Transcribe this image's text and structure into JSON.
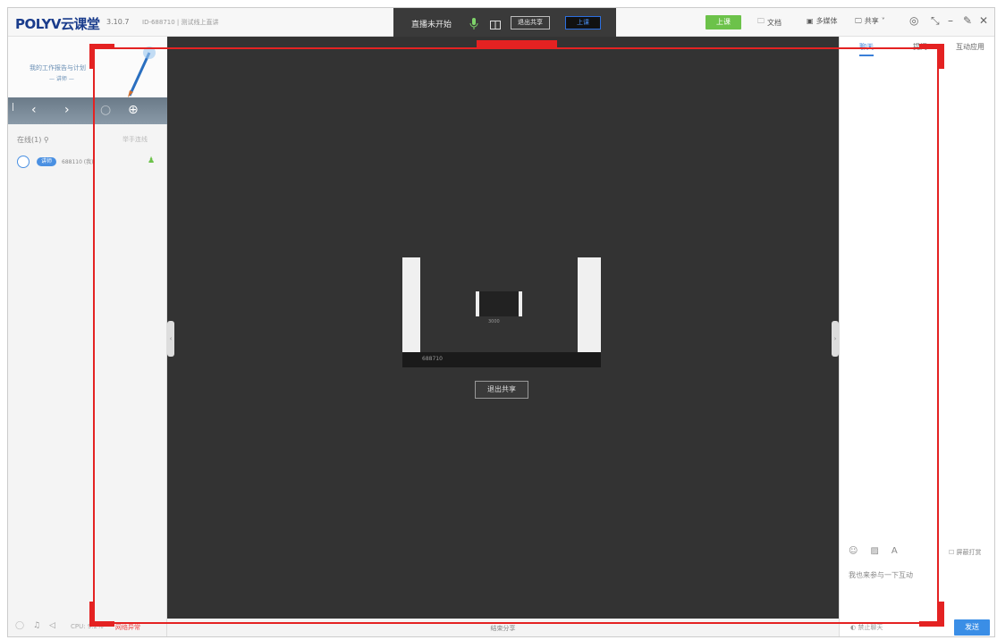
{
  "app": {
    "logo": "POLYV云课堂",
    "version": "3.10.7",
    "room": "ID-688710 | 测试线上直讲"
  },
  "live": {
    "status": "直播未开始",
    "exit_share": "退出共享",
    "class_btn": "上课"
  },
  "toolbar": {
    "start": "上课",
    "docs": "文档",
    "media": "多媒体",
    "share": "共享",
    "share_chevron": "˅",
    "settings": "◎",
    "shrink": "⤡",
    "minimize": "–",
    "pin": "✎",
    "close": "✕"
  },
  "slide": {
    "title": "我的工作报告与计划",
    "subtitle": "— 讲师 —"
  },
  "users": {
    "online": "在线(1)",
    "online_right": "举手连线",
    "tag": "讲师",
    "name": "688110 (我)"
  },
  "status": {
    "cpu": "CPU: 9.2%",
    "net": "网络异常"
  },
  "main": {
    "exit_share": "退出共享",
    "window_id": "688710",
    "mini_label": "3000",
    "stop_share": "结束分享",
    "collapse_left": "‹",
    "collapse_right": "›"
  },
  "right": {
    "tabs": [
      "聊天",
      "提问",
      "互动应用"
    ],
    "mute_all": "屏蔽打赏",
    "input_placeholder": "我也来参与一下互动",
    "forbid": "禁止聊天",
    "send": "发送"
  },
  "colors": {
    "brand": "#1a3c8c",
    "accent": "#3a8ee6",
    "start": "#6cc24a",
    "overlay": "#e42222"
  }
}
